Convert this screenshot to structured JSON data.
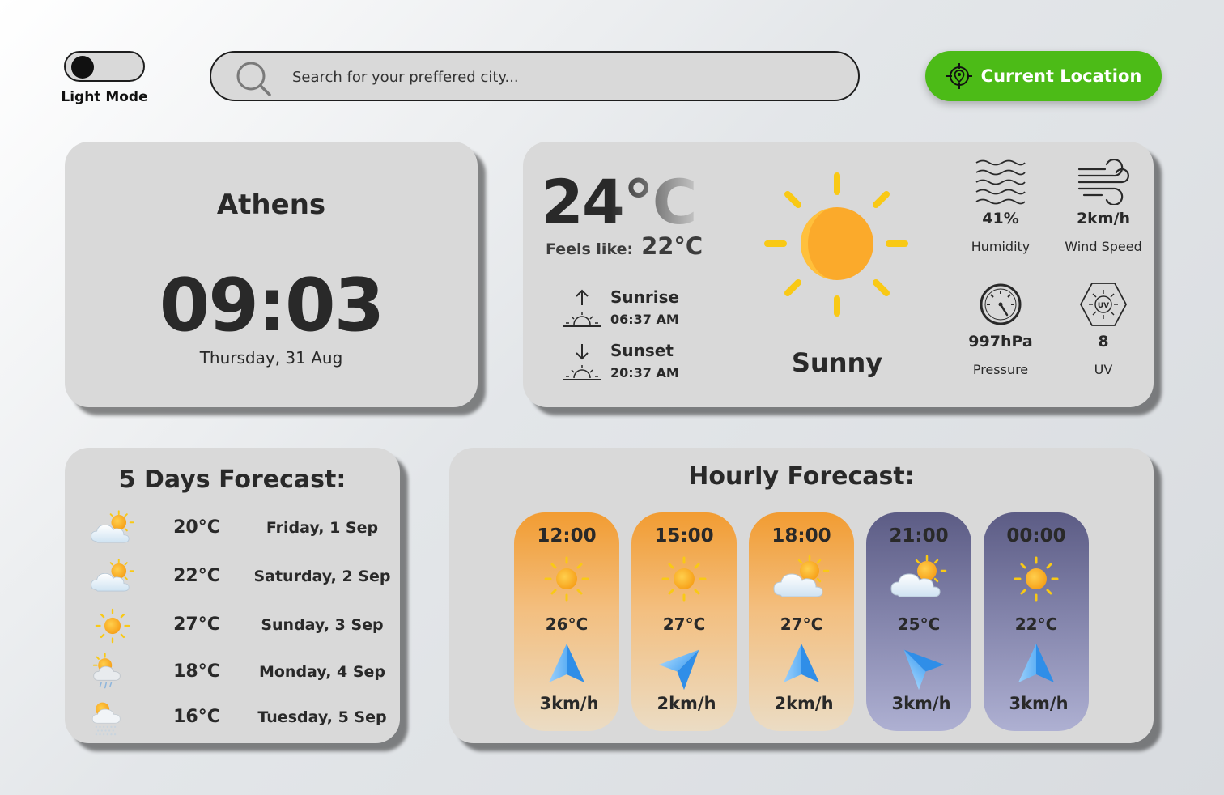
{
  "theme_toggle": {
    "label": "Light Mode"
  },
  "search": {
    "placeholder": "Search for your preffered city..."
  },
  "location_button": {
    "label": "Current Location"
  },
  "city": {
    "name": "Athens",
    "time": "09:03",
    "date": "Thursday, 31 Aug"
  },
  "current": {
    "temperature": "24°C",
    "feels_like_label": "Feels like:",
    "feels_like_value": "22°C",
    "condition": "Sunny",
    "condition_icon": "sun-icon",
    "sunrise": {
      "label": "Sunrise",
      "time": "06:37 AM"
    },
    "sunset": {
      "label": "Sunset",
      "time": "20:37 AM"
    },
    "stats": {
      "humidity": {
        "value": "41%",
        "label": "Humidity",
        "icon": "humidity-waves-icon"
      },
      "wind": {
        "value": "2km/h",
        "label": "Wind Speed",
        "icon": "wind-icon"
      },
      "pressure": {
        "value": "997hPa",
        "label": "Pressure",
        "icon": "pressure-gauge-icon"
      },
      "uv": {
        "value": "8",
        "label": "UV",
        "icon": "uv-icon"
      }
    }
  },
  "five_day": {
    "title": "5 Days Forecast:",
    "days": [
      {
        "temp": "20°C",
        "date": "Friday, 1 Sep",
        "icon": "sun-behind-clouds-icon"
      },
      {
        "temp": "22°C",
        "date": "Saturday, 2 Sep",
        "icon": "cloud-sun-icon"
      },
      {
        "temp": "27°C",
        "date": "Sunday, 3 Sep",
        "icon": "sun-icon"
      },
      {
        "temp": "18°C",
        "date": "Monday, 4 Sep",
        "icon": "sun-cloud-rain-icon"
      },
      {
        "temp": "16°C",
        "date": "Tuesday, 5 Sep",
        "icon": "sun-cloud-snow-icon"
      }
    ]
  },
  "hourly": {
    "title": "Hourly Forecast:",
    "hours": [
      {
        "time": "12:00",
        "temp": "26°C",
        "wind": "3km/h",
        "icon": "sun-icon",
        "direction_deg": 0,
        "period": "day"
      },
      {
        "time": "15:00",
        "temp": "27°C",
        "wind": "2km/h",
        "icon": "sun-icon",
        "direction_deg": 45,
        "period": "day"
      },
      {
        "time": "18:00",
        "temp": "27°C",
        "wind": "2km/h",
        "icon": "sun-behind-clouds-icon",
        "direction_deg": 0,
        "period": "day"
      },
      {
        "time": "21:00",
        "temp": "25°C",
        "wind": "3km/h",
        "icon": "sun-behind-clouds-icon",
        "direction_deg": -45,
        "period": "night"
      },
      {
        "time": "00:00",
        "temp": "22°C",
        "wind": "3km/h",
        "icon": "sun-icon",
        "direction_deg": 0,
        "period": "night"
      }
    ]
  },
  "colors": {
    "accent_green": "#4cbb17",
    "card_bg": "#d9d9d9",
    "text_dark": "#292929",
    "day_gradient_top": "#f29c32",
    "night_gradient_top": "#5c5c85",
    "sun_yellow": "#f9c915",
    "sun_orange": "#fbaa2b",
    "arrow_blue": "#4aa3f0"
  }
}
